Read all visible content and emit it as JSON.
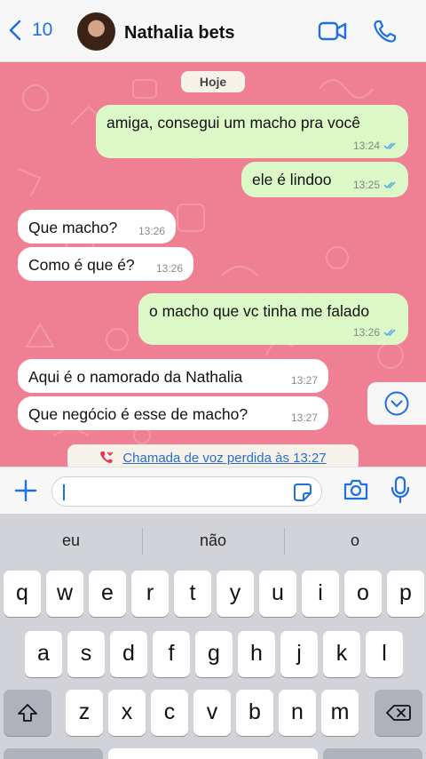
{
  "header": {
    "back_count": "10",
    "contact_name": "Nathalia bets"
  },
  "chat": {
    "date_label": "Hoje",
    "messages": [
      {
        "dir": "out",
        "text": "amiga, consegui um macho pra você",
        "time": "13:24",
        "read": true
      },
      {
        "dir": "out",
        "text": "ele é lindoo",
        "time": "13:25",
        "read": true
      },
      {
        "dir": "in",
        "text": "Que macho?",
        "time": "13:26"
      },
      {
        "dir": "in",
        "text": "Como é que é?",
        "time": "13:26"
      },
      {
        "dir": "out",
        "text": "o macho que vc tinha me falado",
        "time": "13:26",
        "read": true
      },
      {
        "dir": "in",
        "text": "Aqui é o namorado da Nathalia",
        "time": "13:27"
      },
      {
        "dir": "in",
        "text": "Que negócio é esse de macho?",
        "time": "13:27"
      }
    ],
    "missed_call": "Chamada de voz perdida às 13:27"
  },
  "input": {
    "value": ""
  },
  "keyboard": {
    "suggestions": [
      "eu",
      "não",
      "o"
    ],
    "row1": [
      "q",
      "w",
      "e",
      "r",
      "t",
      "y",
      "u",
      "i",
      "o",
      "p"
    ],
    "row2": [
      "a",
      "s",
      "d",
      "f",
      "g",
      "h",
      "j",
      "k",
      "l"
    ],
    "row3": [
      "z",
      "x",
      "c",
      "v",
      "b",
      "n",
      "m"
    ]
  },
  "colors": {
    "chat_background": "#ef8093",
    "outgoing_bubble": "#dcf8c6",
    "incoming_bubble": "#ffffff",
    "accent": "#1f6fe0",
    "read_ticks": "#4fa6e6"
  },
  "icons": [
    "chevron-left-icon",
    "video-call-icon",
    "phone-icon",
    "chevron-down-icon",
    "missed-call-icon",
    "plus-icon",
    "sticker-icon",
    "camera-icon",
    "microphone-icon",
    "shift-icon",
    "backspace-icon"
  ]
}
